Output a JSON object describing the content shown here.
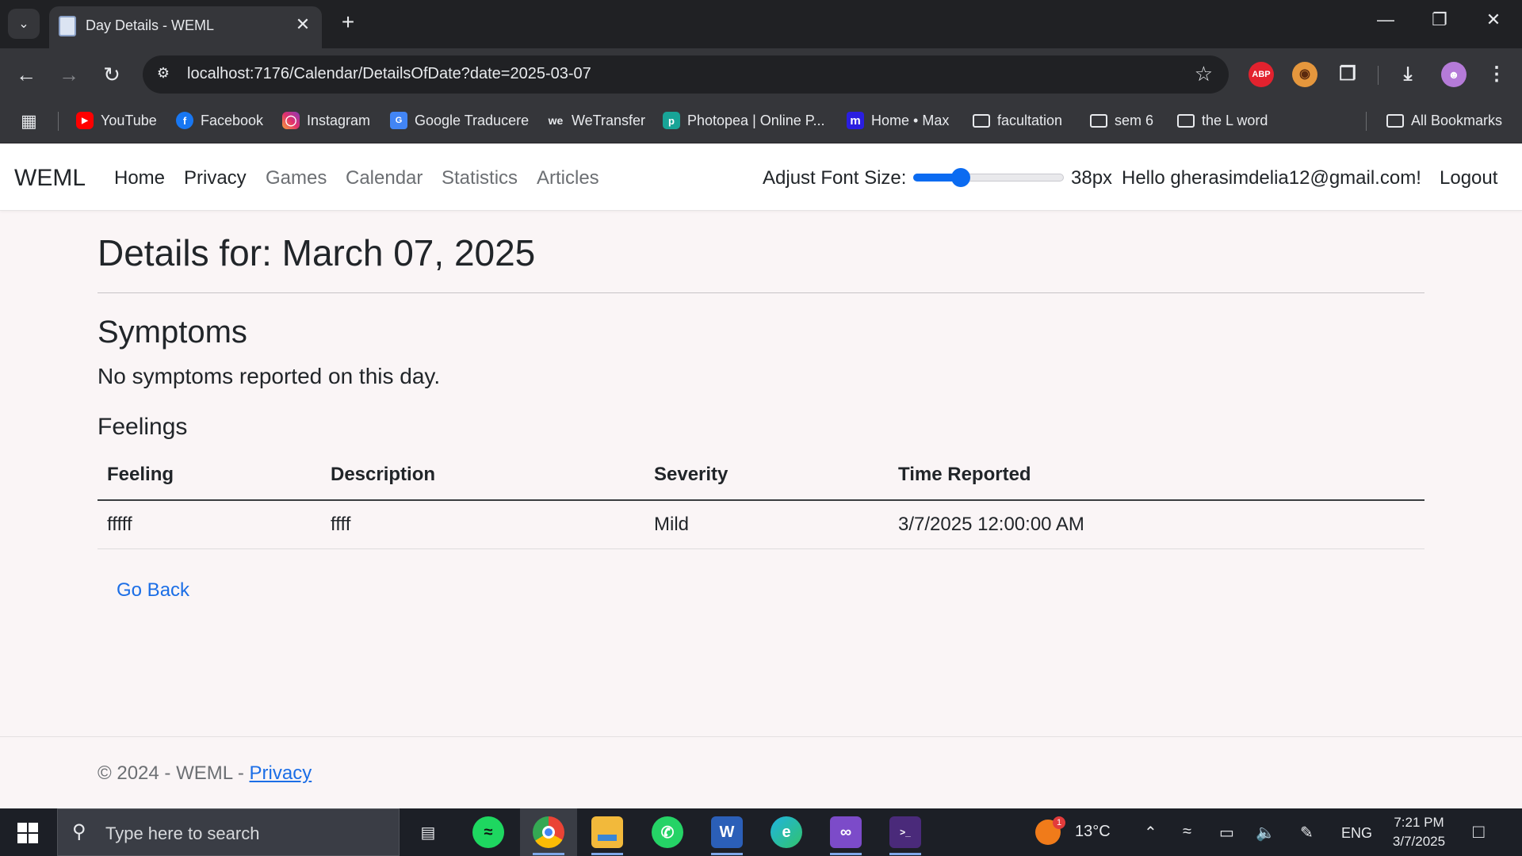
{
  "browser": {
    "tab_title": "Day Details - WEML",
    "url": "localhost:7176/Calendar/DetailsOfDate?date=2025-03-07",
    "bookmarks": [
      {
        "label": "YouTube",
        "icon": "youtube-icon"
      },
      {
        "label": "Facebook",
        "icon": "facebook-icon"
      },
      {
        "label": "Instagram",
        "icon": "instagram-icon"
      },
      {
        "label": "Google Traducere",
        "icon": "google-translate-icon"
      },
      {
        "label": "WeTransfer",
        "icon": "wetransfer-icon"
      },
      {
        "label": "Photopea | Online P...",
        "icon": "photopea-icon"
      },
      {
        "label": "Home • Max",
        "icon": "max-icon"
      },
      {
        "label": "facultation",
        "icon": "folder-icon"
      },
      {
        "label": "sem 6",
        "icon": "folder-icon"
      },
      {
        "label": "the L word",
        "icon": "folder-icon"
      }
    ],
    "all_bookmarks": "All Bookmarks",
    "extension_abp": "ABP"
  },
  "navbar": {
    "brand": "WEML",
    "links": [
      "Home",
      "Privacy",
      "Games",
      "Calendar",
      "Statistics",
      "Articles"
    ],
    "font_label": "Adjust Font Size:",
    "font_value": "38px",
    "font_slider_fraction": 0.29,
    "greeting": "Hello gherasimdelia12@gmail.com!",
    "logout": "Logout"
  },
  "main": {
    "heading": "Details for: March 07, 2025",
    "symptoms_heading": "Symptoms",
    "no_symptoms": "No symptoms reported on this day.",
    "feelings_heading": "Feelings",
    "table": {
      "headers": [
        "Feeling",
        "Description",
        "Severity",
        "Time Reported"
      ],
      "rows": [
        [
          "fffff",
          "ffff",
          "Mild",
          "3/7/2025 12:00:00 AM"
        ]
      ]
    },
    "go_back": "Go Back"
  },
  "footer": {
    "text": "© 2024 - WEML - ",
    "privacy": "Privacy"
  },
  "taskbar": {
    "search_placeholder": "Type here to search",
    "weather": "13°C",
    "weather_badge": "1",
    "language": "ENG",
    "time": "7:21 PM",
    "date": "3/7/2025"
  },
  "colors": {
    "accent": "#0b6bf1",
    "link": "#1b6ee6",
    "page_bg": "#faf5f6"
  }
}
